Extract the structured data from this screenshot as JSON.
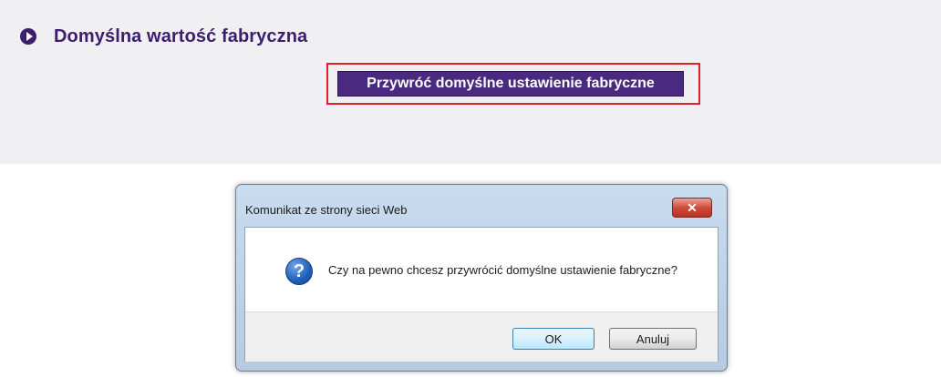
{
  "section": {
    "title": "Domyślna wartość fabryczna",
    "reset_button_label": "Przywróć domyślne ustawienie fabryczne"
  },
  "dialog": {
    "title": "Komunikat ze strony sieci Web",
    "close_glyph": "✕",
    "icon_glyph": "?",
    "message": "Czy na pewno chcesz przywrócić domyślne ustawienie fabryczne?",
    "ok_label": "OK",
    "cancel_label": "Anuluj"
  },
  "colors": {
    "brand_purple": "#3d1d6e",
    "button_purple": "#4a2a80",
    "highlight_red": "#e0202a",
    "panel_gray": "#f0f0f2"
  }
}
